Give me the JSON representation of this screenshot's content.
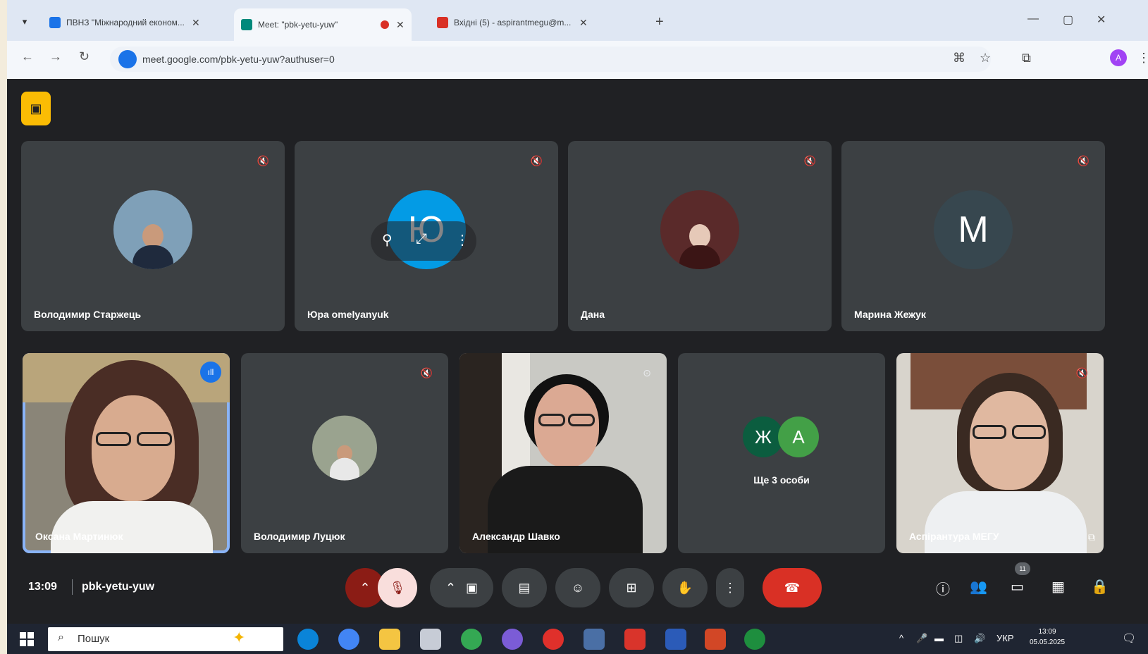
{
  "browser": {
    "tabs": [
      {
        "title": "ПВНЗ \"Міжнародний економ...",
        "favicon_color": "#1a73e8"
      },
      {
        "title": "Meet: \"pbk-yetu-yuw\"",
        "favicon_color": "#00897b"
      },
      {
        "title": "Вхідні (5) - aspirantmegu@m...",
        "favicon_color": "#d93025"
      }
    ],
    "new_tab_icon": "+",
    "url": "meet.google.com/pbk-yetu-yuw?authuser=0"
  },
  "meet": {
    "badge_icon": "people-icon",
    "tiles_top": [
      {
        "name": "Володимир Старжець",
        "avatar": "photo"
      },
      {
        "name": "Юра omelyanyuk",
        "avatar": "Ю",
        "avatar_color": "#039be5"
      },
      {
        "name": "Дана",
        "avatar": "photo"
      },
      {
        "name": "Марина Жежук",
        "avatar": "М",
        "avatar_color": "#37474f"
      }
    ],
    "tiles_bottom": [
      {
        "name": "Оксана Мартинюк",
        "type": "video"
      },
      {
        "name": "Володимир Луцюк",
        "type": "avatar"
      },
      {
        "name": "Александр Шавко",
        "type": "video"
      },
      {
        "name": "Ще 3 особи",
        "type": "group",
        "initials": [
          "Ж",
          "А"
        ],
        "initial_colors": [
          "#0b5d3f",
          "#43a047"
        ]
      },
      {
        "name": "Аспірантура МЕГУ",
        "type": "video"
      }
    ],
    "time": "13:09",
    "meeting_code": "pbk-yetu-yuw",
    "participants_count": "11"
  },
  "taskbar": {
    "search_placeholder": "Пошук",
    "lang": "УКР",
    "time": "13:09",
    "date": "05.05.2025"
  }
}
